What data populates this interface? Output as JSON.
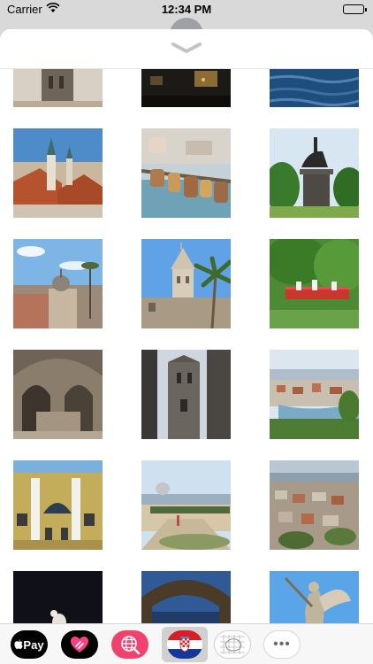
{
  "status_bar": {
    "carrier": "Carrier",
    "time": "12:34 PM",
    "wifi_icon": "wifi-icon",
    "battery_icon": "battery-icon"
  },
  "sheet": {
    "collapse_icon": "chevron-down-icon"
  },
  "gallery": {
    "photos": [
      {
        "subject": "bell tower top"
      },
      {
        "subject": "night waterfront"
      },
      {
        "subject": "blue sea water"
      },
      {
        "subject": "red rooftops with church spire"
      },
      {
        "subject": "love padlocks on railing"
      },
      {
        "subject": "equestrian statue in park"
      },
      {
        "subject": "old town skyline with dome"
      },
      {
        "subject": "bell tower with palm tree"
      },
      {
        "subject": "red bridge in park"
      },
      {
        "subject": "vaulted stone cellar"
      },
      {
        "subject": "bell tower between stone walls"
      },
      {
        "subject": "city panorama over harbour"
      },
      {
        "subject": "theatre facade"
      },
      {
        "subject": "seaside promenade"
      },
      {
        "subject": "hillside houses"
      },
      {
        "subject": "dark interior with figure"
      },
      {
        "subject": "arched colonnade at dusk"
      },
      {
        "subject": "angel statue"
      }
    ]
  },
  "app_drawer": {
    "apple_pay_label": "Pay",
    "apple_pay_icon": "apple-pay-icon",
    "heart_icon": "digital-touch-heart-icon",
    "globe_icon": "image-search-globe-icon",
    "flag_icon": "croatia-flag-icon",
    "map_icon": "map-grid-icon",
    "more_label": "•••",
    "more_icon": "more-ellipsis-icon"
  },
  "colors": {
    "accent_pink": "#f0426e",
    "flag_red": "#d81e22",
    "flag_blue": "#16389a"
  }
}
